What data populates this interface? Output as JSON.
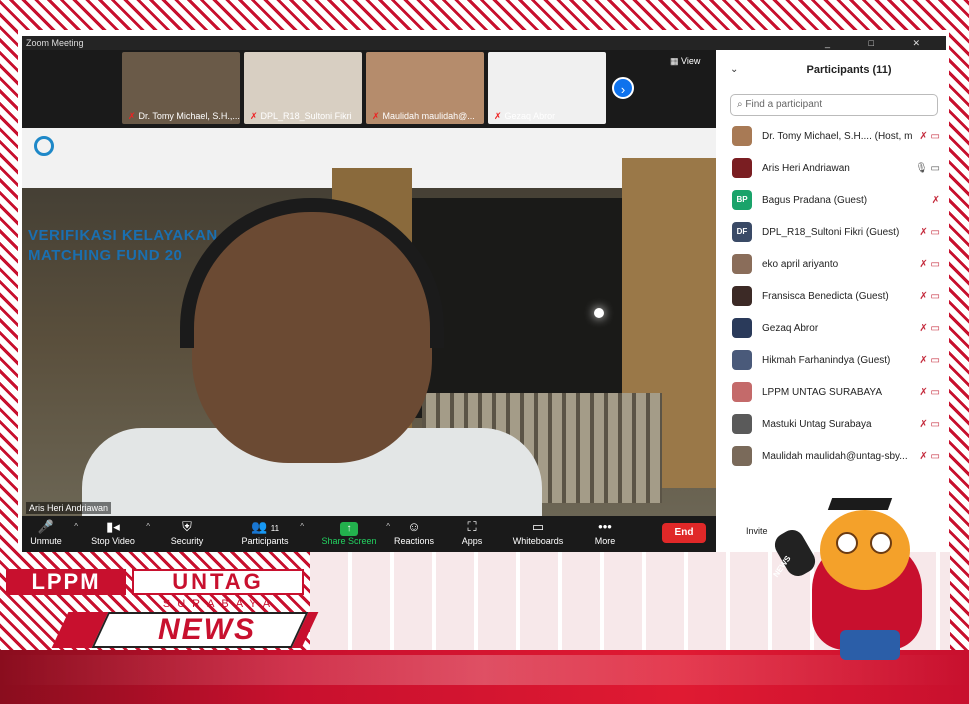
{
  "window": {
    "title": "Zoom Meeting",
    "controls": "_ □ ✕"
  },
  "strip": {
    "tiles": [
      {
        "name": "Dr. Tomy Michael, S.H.,...",
        "muted": true,
        "bg": "#6a5a48"
      },
      {
        "name": "DPL_R18_Sultoni Fikri",
        "muted": true,
        "bg": "#d8cfc2"
      },
      {
        "name": "Maulidah maulidah@...",
        "muted": true,
        "bg": "#b58c6c"
      },
      {
        "name": "Gezaq Abror",
        "muted": true,
        "bg": "#f0f0f0"
      }
    ],
    "next_icon": "›",
    "view_label": "View",
    "view_icon": "▦"
  },
  "main_video": {
    "speaker_name": "Aris Heri Andriawan",
    "banner_text_1": "VERIFIKASI KELAYAKAN",
    "banner_text_2": "MATCHING FUND 20"
  },
  "toolbar": {
    "items": [
      {
        "label": "Unmute",
        "icon": "🎤"
      },
      {
        "label": "Stop Video",
        "icon": "▮◂"
      },
      {
        "label": "Security",
        "icon": "⛨"
      },
      {
        "label": "Participants",
        "icon": "👥",
        "count": "11"
      },
      {
        "label": "Share Screen",
        "icon": "↑"
      },
      {
        "label": "Reactions",
        "icon": "☺"
      },
      {
        "label": "Apps",
        "icon": "⛶"
      },
      {
        "label": "Whiteboards",
        "icon": "▭"
      },
      {
        "label": "More",
        "icon": "•••"
      }
    ],
    "end_label": "End"
  },
  "participants": {
    "title": "Participants (11)",
    "search_placeholder": "Find a participant",
    "list": [
      {
        "name": "Dr. Tomy Michael, S.H.... (Host, me)",
        "initials": "",
        "color": "#a87a55",
        "icons": "✗ ▭"
      },
      {
        "name": "Aris Heri Andriawan",
        "initials": "",
        "color": "#7a1e22",
        "icons": "🎙 ▭"
      },
      {
        "name": "Bagus Pradana (Guest)",
        "initials": "BP",
        "color": "#1aa36a",
        "icons": "✗"
      },
      {
        "name": "DPL_R18_Sultoni Fikri (Guest)",
        "initials": "DF",
        "color": "#3a4a66",
        "icons": "✗ ▭"
      },
      {
        "name": "eko april ariyanto",
        "initials": "",
        "color": "#8a6d5a",
        "icons": "✗ ▭"
      },
      {
        "name": "Fransisca Benedicta (Guest)",
        "initials": "",
        "color": "#3c2a26",
        "icons": "✗ ▭"
      },
      {
        "name": "Gezaq Abror",
        "initials": "",
        "color": "#2a3a5a",
        "icons": "✗ ▭"
      },
      {
        "name": "Hikmah Farhanindya (Guest)",
        "initials": "",
        "color": "#4a5a7a",
        "icons": "✗ ▭"
      },
      {
        "name": "LPPM UNTAG SURABAYA",
        "initials": "",
        "color": "#c46a6a",
        "icons": "✗ ▭"
      },
      {
        "name": "Mastuki Untag Surabaya",
        "initials": "",
        "color": "#5a5a5a",
        "icons": "✗ ▭"
      },
      {
        "name": "Maulidah maulidah@untag-sby...",
        "initials": "",
        "color": "#7a6a5a",
        "icons": "✗ ▭"
      }
    ],
    "invite_label": "Invite"
  },
  "branding": {
    "lppm": "LPPM",
    "untag": "UNTAG",
    "surabaya": "SURABAYA",
    "news": "NEWS",
    "mascot_mic_label": "NEWS"
  }
}
